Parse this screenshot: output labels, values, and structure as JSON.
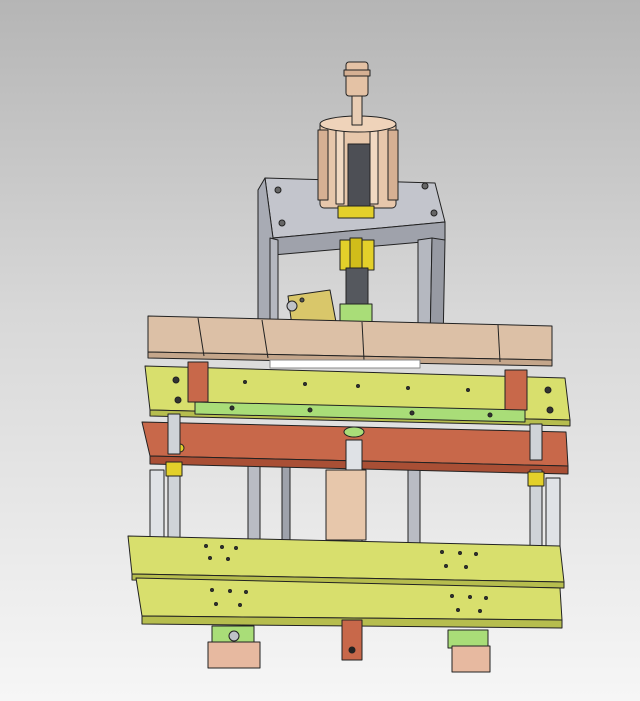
{
  "viewport": {
    "background_top": "#b5b5b5",
    "background_bottom": "#f6f6f6"
  },
  "model": {
    "type": "3D CAD assembly render (isometric, shaded with edges)",
    "components": [
      "pneumatic-cylinder",
      "cylinder-mount-bracket",
      "piston-rod",
      "tan-base-plate",
      "upper-green-plate",
      "green-guide-rail",
      "orange-mid-plate",
      "lower-green-plate-top",
      "lower-green-plate-bottom",
      "guide-pillar",
      "feet-blocks"
    ],
    "colors": {
      "cylinder_body": "#e5c4a8",
      "bracket": "#b7b9c2",
      "yellow_parts": "#e2cf2a",
      "green_plates": "#d8df6d",
      "guide_rail": "#a9dd78",
      "orange_plate": "#c8684a",
      "tan_plate": "#dcc0a6",
      "pillars": "#cfd3d8",
      "feet": "#e7b9a0",
      "edges": "#222222"
    }
  }
}
